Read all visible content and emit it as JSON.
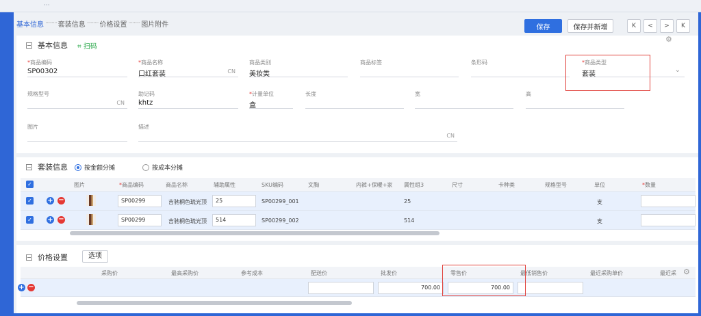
{
  "top_tabs": [
    "基本信息",
    "套装信息",
    "价格设置",
    "图片附件"
  ],
  "toolbar": {
    "save": "保存",
    "save_new": "保存并新增",
    "nav": [
      "K",
      "<",
      ">",
      "K"
    ]
  },
  "basic": {
    "title": "基本信息",
    "scan": "扫码",
    "fields": [
      {
        "label": "商品编码",
        "required": true,
        "value": "SP00302",
        "cn": ""
      },
      {
        "label": "商品名称",
        "required": true,
        "value": "口红套装",
        "cn": "CN"
      },
      {
        "label": "商品类别",
        "required": false,
        "value": "美妆类",
        "cn": ""
      },
      {
        "label": "商品标签",
        "required": false,
        "value": "",
        "cn": ""
      },
      {
        "label": "条形码",
        "required": false,
        "value": "",
        "cn": ""
      },
      {
        "label": "商品类型",
        "required": true,
        "value": "套装",
        "cn": ""
      },
      {
        "label": "规格型号",
        "required": false,
        "value": "",
        "cn": "CN"
      },
      {
        "label": "助记码",
        "required": false,
        "value": "khtz",
        "cn": ""
      },
      {
        "label": "计量单位",
        "required": true,
        "value": "盒",
        "cn": ""
      },
      {
        "label": "长度",
        "required": false,
        "value": "",
        "cn": ""
      },
      {
        "label": "宽",
        "required": false,
        "value": "",
        "cn": ""
      },
      {
        "label": "高",
        "required": false,
        "value": "",
        "cn": ""
      },
      {
        "label": "图片",
        "required": false,
        "value": "",
        "cn": ""
      },
      {
        "label": "描述",
        "required": false,
        "value": "",
        "cn": "CN"
      }
    ]
  },
  "kit": {
    "title": "套装信息",
    "radio_amount": "按金额分摊",
    "radio_cost": "按成本分摊",
    "headers": [
      "图片",
      "商品编码",
      "商品名称",
      "辅助属性",
      "SKU编码",
      "文胸",
      "内裤+保暖+家",
      "属性组3",
      "尺寸",
      "卡种类",
      "规格型号",
      "单位",
      "数量"
    ],
    "rows": [
      {
        "code": "SP00299",
        "name": "吉驰桐色琉光顶",
        "attr": "25",
        "sku": "SP00299_001",
        "group3": "25",
        "unit": "支",
        "qty": ""
      },
      {
        "code": "SP00299",
        "name": "吉驰桐色琉光顶",
        "attr": "514",
        "sku": "SP00299_002",
        "group3": "514",
        "unit": "支",
        "qty": ""
      }
    ]
  },
  "price": {
    "title": "价格设置",
    "options": "选项",
    "headers": [
      "采购价",
      "最高采购价",
      "参考成本",
      "配送价",
      "批发价",
      "零售价",
      "最低销售价",
      "最近采购单价",
      "最近采"
    ],
    "values": {
      "wholesale": "700.00",
      "retail": "700.00"
    }
  }
}
